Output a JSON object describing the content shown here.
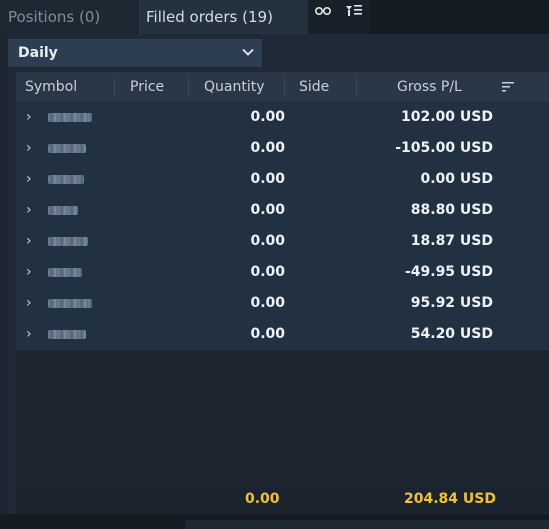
{
  "tabs": [
    {
      "label": "Positions (0)"
    },
    {
      "label": "Filled orders (19)"
    }
  ],
  "toolbar_icons": [
    "link-icon",
    "filter-icon"
  ],
  "period": {
    "selected": "Daily"
  },
  "columns": {
    "symbol": "Symbol",
    "price": "Price",
    "quantity": "Quantity",
    "side": "Side",
    "gross_pl": "Gross P/L"
  },
  "rows": [
    {
      "quantity": "0.00",
      "gross_pl": "102.00 USD"
    },
    {
      "quantity": "0.00",
      "gross_pl": "-105.00 USD"
    },
    {
      "quantity": "0.00",
      "gross_pl": "0.00 USD"
    },
    {
      "quantity": "0.00",
      "gross_pl": "88.80 USD"
    },
    {
      "quantity": "0.00",
      "gross_pl": "18.87 USD"
    },
    {
      "quantity": "0.00",
      "gross_pl": "-49.95 USD"
    },
    {
      "quantity": "0.00",
      "gross_pl": "95.92 USD"
    },
    {
      "quantity": "0.00",
      "gross_pl": "54.20 USD"
    }
  ],
  "totals": {
    "quantity": "0.00",
    "gross_pl": "204.84 USD"
  },
  "colors": {
    "total_text": "#f0c23b",
    "accent_bg": "#2d3e52"
  }
}
